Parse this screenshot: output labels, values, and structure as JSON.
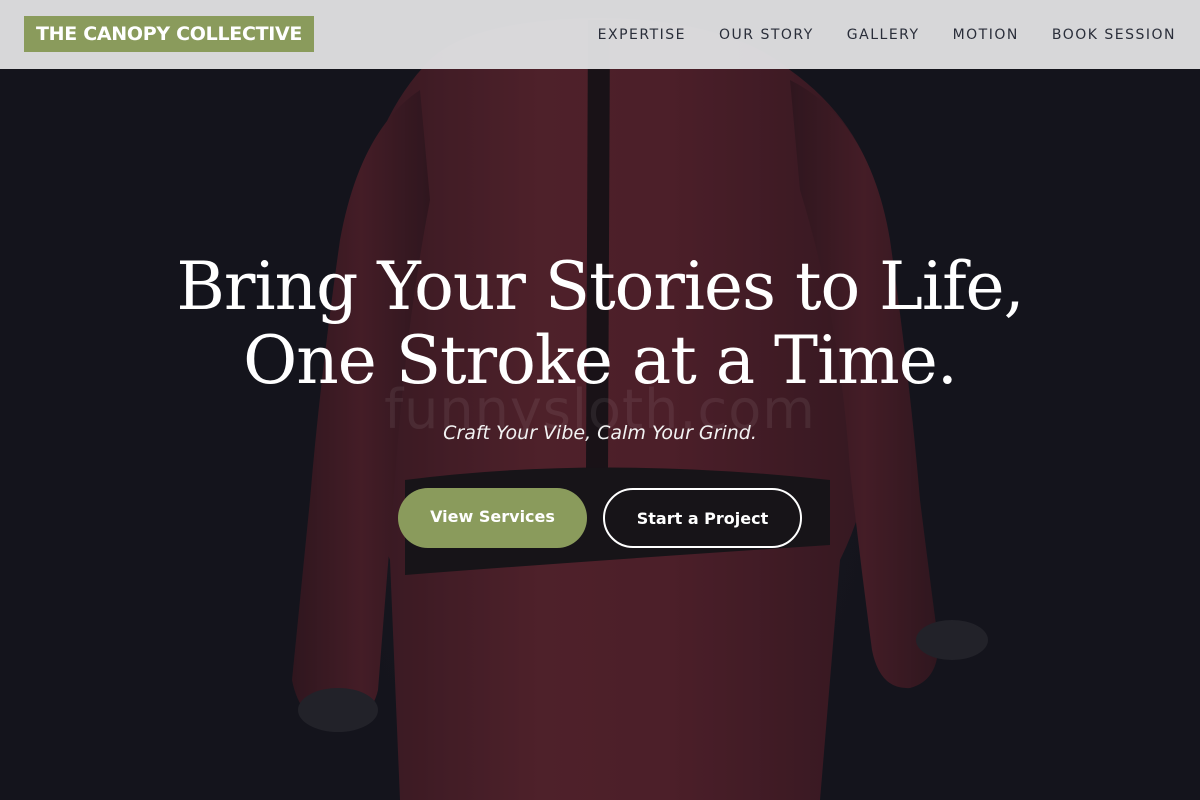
{
  "header": {
    "logo_text": "THE CANOPY COLLECTIVE",
    "nav": [
      {
        "label": "EXPERTISE"
      },
      {
        "label": "OUR STORY"
      },
      {
        "label": "GALLERY"
      },
      {
        "label": "MOTION"
      },
      {
        "label": "BOOK SESSION"
      }
    ]
  },
  "hero": {
    "title_line1": "Bring Your Stories to Life,",
    "title_line2": "One Stroke at a Time.",
    "watermark": "funnysloth.com",
    "tagline": "Craft Your Vibe, Calm Your Grind.",
    "primary_cta": "View Services",
    "secondary_cta": "Start a Project"
  },
  "colors": {
    "accent": "#8a9b5c",
    "header_bg": "#dededf",
    "hero_bg": "#15151d",
    "suit": "#6a2530"
  },
  "background": {
    "image": "figure-in-red-suit-rear-view"
  }
}
